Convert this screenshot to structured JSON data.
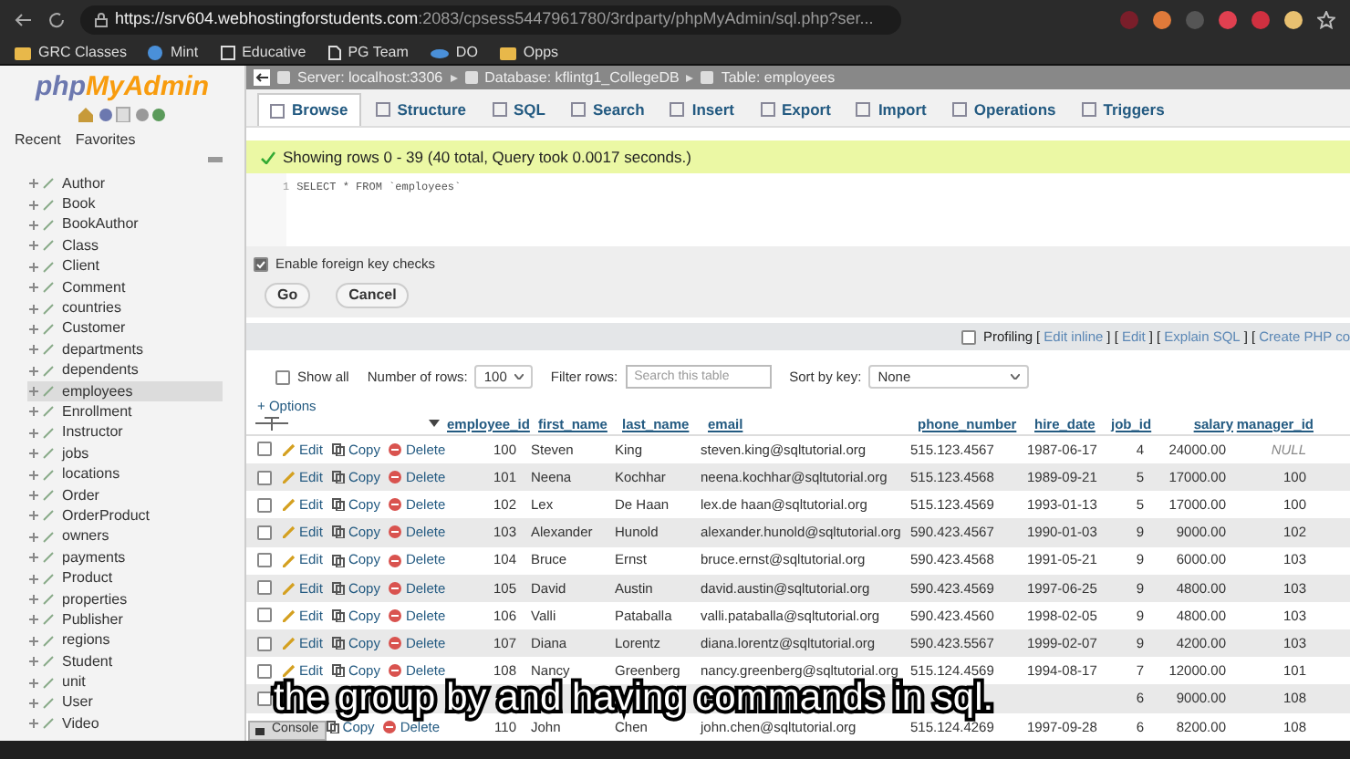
{
  "browser": {
    "url_host": "https://srv604.webhostingforstudents.com",
    "url_rest": ":2083/cpsess5447961780/3rdparty/phpMyAdmin/sql.php?ser...",
    "bookmarks": [
      {
        "label": "GRC Classes",
        "kind": "folder"
      },
      {
        "label": "Mint",
        "kind": "globe"
      },
      {
        "label": "Educative",
        "kind": "app"
      },
      {
        "label": "PG Team",
        "kind": "page"
      },
      {
        "label": "DO",
        "kind": "cloud"
      },
      {
        "label": "Opps",
        "kind": "folder"
      }
    ]
  },
  "sidebar": {
    "logo_a": "php",
    "logo_b": "MyAdmin",
    "tabs": [
      "Recent",
      "Favorites"
    ],
    "items": [
      {
        "label": "Author",
        "selected": false
      },
      {
        "label": "Book",
        "selected": false
      },
      {
        "label": "BookAuthor",
        "selected": false
      },
      {
        "label": "Class",
        "selected": false
      },
      {
        "label": "Client",
        "selected": false
      },
      {
        "label": "Comment",
        "selected": false
      },
      {
        "label": "countries",
        "selected": false
      },
      {
        "label": "Customer",
        "selected": false
      },
      {
        "label": "departments",
        "selected": false
      },
      {
        "label": "dependents",
        "selected": false
      },
      {
        "label": "employees",
        "selected": true
      },
      {
        "label": "Enrollment",
        "selected": false
      },
      {
        "label": "Instructor",
        "selected": false
      },
      {
        "label": "jobs",
        "selected": false
      },
      {
        "label": "locations",
        "selected": false
      },
      {
        "label": "Order",
        "selected": false
      },
      {
        "label": "OrderProduct",
        "selected": false
      },
      {
        "label": "owners",
        "selected": false
      },
      {
        "label": "payments",
        "selected": false
      },
      {
        "label": "Product",
        "selected": false
      },
      {
        "label": "properties",
        "selected": false
      },
      {
        "label": "Publisher",
        "selected": false
      },
      {
        "label": "regions",
        "selected": false
      },
      {
        "label": "Student",
        "selected": false
      },
      {
        "label": "unit",
        "selected": false
      },
      {
        "label": "User",
        "selected": false
      },
      {
        "label": "Video",
        "selected": false
      }
    ]
  },
  "breadcrumb": [
    "Server: localhost:3306",
    "Database: kflintg1_CollegeDB",
    "Table: employees"
  ],
  "tabs": [
    {
      "label": "Browse",
      "selected": true
    },
    {
      "label": "Structure",
      "selected": false
    },
    {
      "label": "SQL",
      "selected": false
    },
    {
      "label": "Search",
      "selected": false
    },
    {
      "label": "Insert",
      "selected": false
    },
    {
      "label": "Export",
      "selected": false
    },
    {
      "label": "Import",
      "selected": false
    },
    {
      "label": "Operations",
      "selected": false
    },
    {
      "label": "Triggers",
      "selected": false
    }
  ],
  "message": "Showing rows 0 - 39 (40 total, Query took 0.0017 seconds.)",
  "query": {
    "line": "1",
    "text": "SELECT * FROM `employees`"
  },
  "foreign_key_checks": {
    "label": "Enable foreign key checks",
    "checked": true
  },
  "buttons": [
    "Go",
    "Cancel"
  ],
  "profiling": {
    "label": "Profiling",
    "checked": false,
    "parts": [
      {
        "kind": "text",
        "text": "["
      },
      {
        "kind": "link",
        "text": "Edit inline"
      },
      {
        "kind": "text",
        "text": "] ["
      },
      {
        "kind": "link",
        "text": "Edit"
      },
      {
        "kind": "text",
        "text": "] ["
      },
      {
        "kind": "link",
        "text": "Explain SQL"
      },
      {
        "kind": "text",
        "text": "] ["
      },
      {
        "kind": "link",
        "text": "Create PHP co"
      }
    ]
  },
  "controls": {
    "show_all": {
      "label": "Show all",
      "checked": false
    },
    "rows_label": "Number of rows:",
    "rows_value": "100",
    "filter_label": "Filter rows:",
    "filter_placeholder": "Search this table",
    "sort_label": "Sort by key:",
    "sort_value": "None"
  },
  "options_link": "+ Options",
  "table": {
    "columns": [
      "employee_id",
      "first_name",
      "last_name",
      "email",
      "phone_number",
      "hire_date",
      "job_id",
      "salary",
      "manager_id"
    ],
    "rows": [
      {
        "checked": false,
        "actions": [
          "Edit",
          "Copy",
          "Delete"
        ],
        "cells": [
          "100",
          "Steven",
          "King",
          "steven.king@sqltutorial.org",
          "515.123.4567",
          "1987-06-17",
          "4",
          "24000.00",
          "NULL"
        ]
      },
      {
        "checked": false,
        "actions": [
          "Edit",
          "Copy",
          "Delete"
        ],
        "cells": [
          "101",
          "Neena",
          "Kochhar",
          "neena.kochhar@sqltutorial.org",
          "515.123.4568",
          "1989-09-21",
          "5",
          "17000.00",
          "100"
        ]
      },
      {
        "checked": false,
        "actions": [
          "Edit",
          "Copy",
          "Delete"
        ],
        "cells": [
          "102",
          "Lex",
          "De Haan",
          "lex.de haan@sqltutorial.org",
          "515.123.4569",
          "1993-01-13",
          "5",
          "17000.00",
          "100"
        ]
      },
      {
        "checked": false,
        "actions": [
          "Edit",
          "Copy",
          "Delete"
        ],
        "cells": [
          "103",
          "Alexander",
          "Hunold",
          "alexander.hunold@sqltutorial.org",
          "590.423.4567",
          "1990-01-03",
          "9",
          "9000.00",
          "102"
        ]
      },
      {
        "checked": false,
        "actions": [
          "Edit",
          "Copy",
          "Delete"
        ],
        "cells": [
          "104",
          "Bruce",
          "Ernst",
          "bruce.ernst@sqltutorial.org",
          "590.423.4568",
          "1991-05-21",
          "9",
          "6000.00",
          "103"
        ]
      },
      {
        "checked": false,
        "actions": [
          "Edit",
          "Copy",
          "Delete"
        ],
        "cells": [
          "105",
          "David",
          "Austin",
          "david.austin@sqltutorial.org",
          "590.423.4569",
          "1997-06-25",
          "9",
          "4800.00",
          "103"
        ]
      },
      {
        "checked": false,
        "actions": [
          "Edit",
          "Copy",
          "Delete"
        ],
        "cells": [
          "106",
          "Valli",
          "Pataballa",
          "valli.pataballa@sqltutorial.org",
          "590.423.4560",
          "1998-02-05",
          "9",
          "4800.00",
          "103"
        ]
      },
      {
        "checked": false,
        "actions": [
          "Edit",
          "Copy",
          "Delete"
        ],
        "cells": [
          "107",
          "Diana",
          "Lorentz",
          "diana.lorentz@sqltutorial.org",
          "590.423.5567",
          "1999-02-07",
          "9",
          "4200.00",
          "103"
        ]
      },
      {
        "checked": false,
        "actions": [
          "Edit",
          "Copy",
          "Delete"
        ],
        "cells": [
          "108",
          "Nancy",
          "Greenberg",
          "nancy.greenberg@sqltutorial.org",
          "515.124.4569",
          "1994-08-17",
          "7",
          "12000.00",
          "101"
        ]
      },
      {
        "checked": false,
        "actions": [],
        "cells": [
          null,
          null,
          null,
          null,
          null,
          null,
          "6",
          "9000.00",
          "108"
        ]
      },
      {
        "actions": [
          "Copy",
          "Delete"
        ],
        "cells": [
          "110",
          "John",
          "Chen",
          "john.chen@sqltutorial.org",
          "515.124.4269",
          "1997-09-28",
          "6",
          "8200.00",
          "108"
        ]
      }
    ]
  },
  "console": "Console",
  "caption": "the group by and having commands in sql."
}
